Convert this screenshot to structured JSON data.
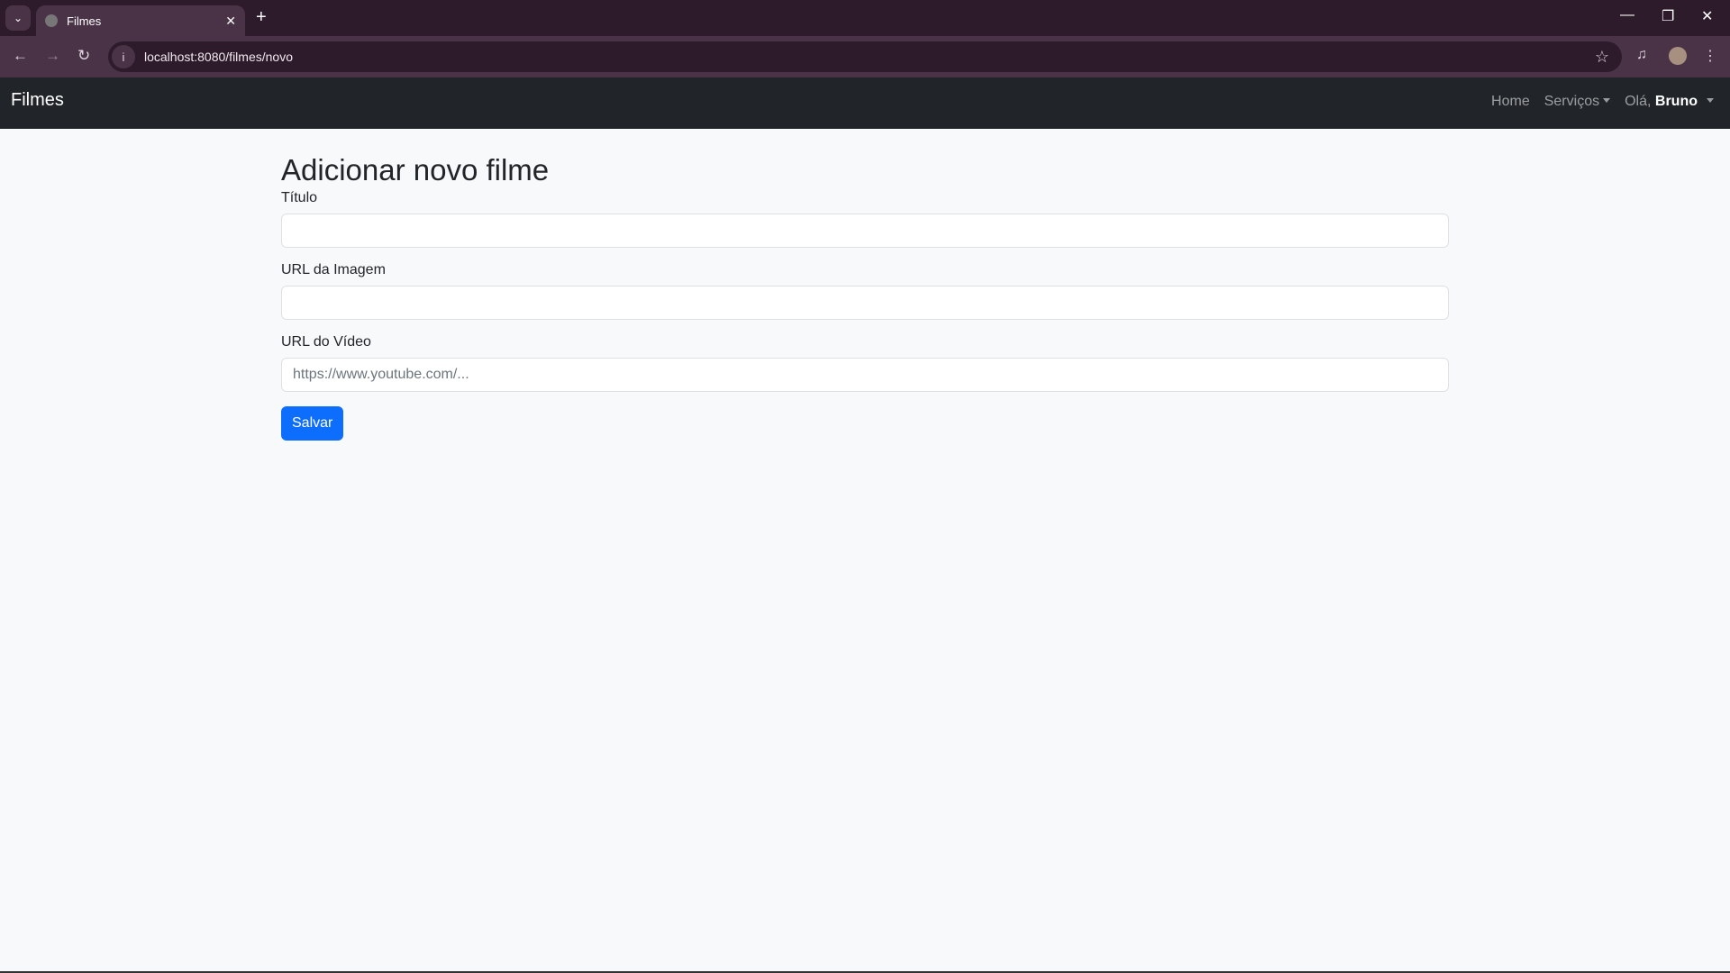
{
  "browser": {
    "tab_title": "Filmes",
    "url": "localhost:8080/filmes/novo"
  },
  "navbar": {
    "brand": "Filmes",
    "home": "Home",
    "services": "Serviços",
    "greeting": "Olá,",
    "user": "Bruno"
  },
  "form": {
    "heading": "Adicionar novo filme",
    "fields": [
      {
        "label": "Título",
        "value": "",
        "placeholder": ""
      },
      {
        "label": "URL da Imagem",
        "value": "",
        "placeholder": ""
      },
      {
        "label": "URL do Vídeo",
        "value": "",
        "placeholder": "https://www.youtube.com/..."
      }
    ],
    "submit": "Salvar"
  }
}
